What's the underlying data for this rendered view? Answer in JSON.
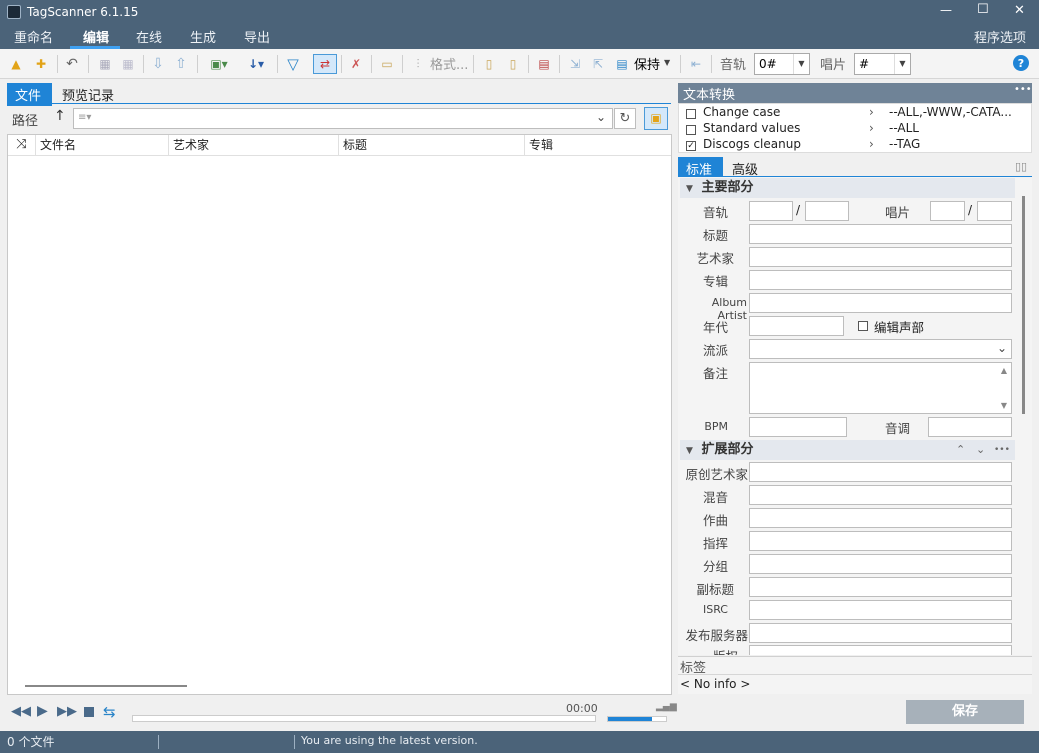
{
  "window": {
    "title": "TagScanner 6.1.15",
    "minimize": "—",
    "maximize": "☐",
    "close": "✕"
  },
  "menu": {
    "items": [
      "重命名",
      "编辑",
      "在线",
      "生成",
      "导出"
    ],
    "active": "编辑",
    "options": "程序选项"
  },
  "toolbar": {
    "format_label": "格式...",
    "keep_label": "保持",
    "track_label": "音轨",
    "track_value": "0#",
    "disc_label": "唱片",
    "disc_value": "#",
    "help": "?"
  },
  "left": {
    "tabs": [
      "文件",
      "预览记录"
    ],
    "path_label": "路径",
    "path_value": "",
    "columns": [
      "文件名",
      "艺术家",
      "标题",
      "专辑"
    ]
  },
  "player": {
    "time": "00:00"
  },
  "save_label": "保存",
  "text_convert": {
    "title": "文本转换",
    "more": "•••",
    "items": [
      {
        "label": "Change case",
        "value": "--ALL,-WWW,-CATA...",
        "checked": false
      },
      {
        "label": "Standard values",
        "value": "--ALL",
        "checked": false
      },
      {
        "label": "Discogs cleanup",
        "value": "--TAG",
        "checked": true
      }
    ]
  },
  "editor": {
    "tabs": [
      "标准",
      "高级"
    ],
    "main_section": "主要部分",
    "labels": {
      "track": "音轨",
      "disc": "唱片",
      "title": "标题",
      "artist": "艺术家",
      "album": "专辑",
      "album_artist": "Album Artist",
      "year": "年代",
      "compilation": "编辑声部",
      "genre": "流派",
      "comment": "备注",
      "bpm": "BPM",
      "key": "音调"
    },
    "ext_section": "扩展部分",
    "ext_labels": [
      "原创艺术家",
      "混音",
      "作曲",
      "指挥",
      "分组",
      "副标题",
      "ISRC",
      "发布服务器",
      "版权"
    ]
  },
  "tag_panel": {
    "title": "标签",
    "info": "< No info >"
  },
  "status": {
    "files": "0 个文件",
    "message": "You are using the latest version."
  }
}
